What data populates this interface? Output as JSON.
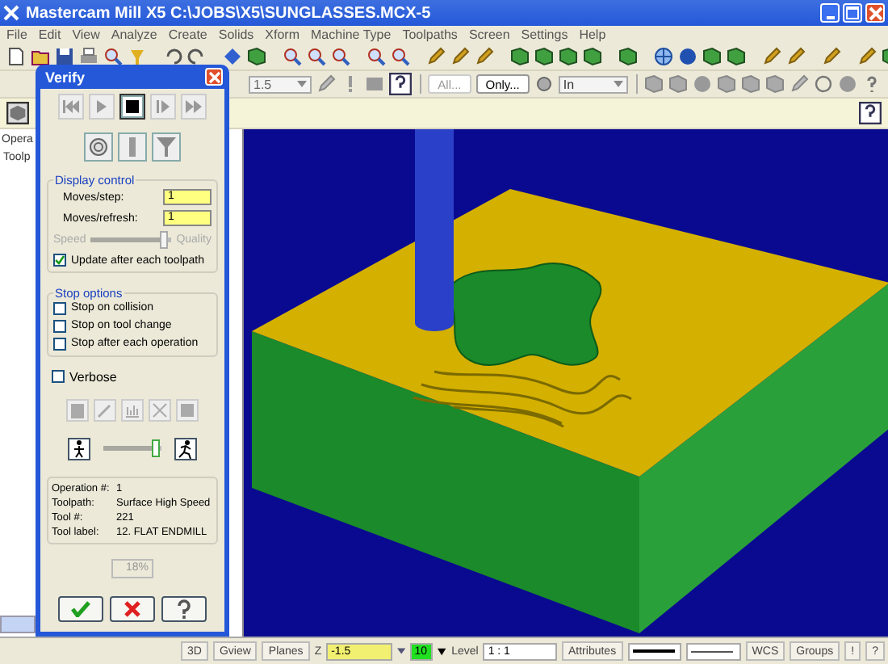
{
  "window": {
    "title": "Mastercam Mill X5  C:\\JOBS\\X5\\SUNGLASSES.MCX-5"
  },
  "menu": [
    "File",
    "Edit",
    "View",
    "Analyze",
    "Create",
    "Solids",
    "Xform",
    "Machine Type",
    "Toolpaths",
    "Screen",
    "Settings",
    "Help"
  ],
  "toolbar": {
    "depth_value": "1.5",
    "buttons": [
      "All...",
      "Only..."
    ],
    "combo_value": "In"
  },
  "operations_manager": {
    "tab": "Opera",
    "subtab": "Toolp"
  },
  "verify": {
    "title": "Verify",
    "playback": [
      {
        "kind": "rewind",
        "selected": false
      },
      {
        "kind": "play",
        "selected": false
      },
      {
        "kind": "stop",
        "selected": true
      },
      {
        "kind": "step",
        "selected": false
      },
      {
        "kind": "fast",
        "selected": false
      }
    ],
    "display_control": {
      "title": "Display control",
      "fields": [
        {
          "label": "Moves/step:",
          "value": "1"
        },
        {
          "label": "Moves/refresh:",
          "value": "1"
        }
      ],
      "speed_label": "Speed",
      "quality_label": "Quality",
      "slider": {
        "level": 0.95
      },
      "update_label": "Update after each toolpath",
      "update_checked": true
    },
    "stop_options": {
      "title": "Stop options",
      "items": [
        {
          "label": "Stop on collision",
          "checked": false
        },
        {
          "label": "Stop on tool change",
          "checked": false
        },
        {
          "label": "Stop after each operation",
          "checked": false
        }
      ]
    },
    "verbose": {
      "label": "Verbose",
      "checked": false
    },
    "sim_speed": {
      "level": 0.97
    },
    "info": [
      {
        "label": "Operation #:",
        "value": "1"
      },
      {
        "label": "Toolpath:",
        "value": "Surface High Speed"
      },
      {
        "label": "Tool #:",
        "value": "221"
      },
      {
        "label": "Tool label:",
        "value": "12. FLAT ENDMILL"
      }
    ],
    "progress": "18%"
  },
  "status_bar": {
    "buttons": [
      "3D",
      "Gview",
      "Planes"
    ],
    "z_label": "Z",
    "z_value": "-1.5",
    "color_value": "10",
    "level_label": "Level",
    "level_value": "1 : 1",
    "attributes": "Attributes",
    "right_buttons": [
      "WCS",
      "Groups",
      "!",
      "?"
    ]
  }
}
